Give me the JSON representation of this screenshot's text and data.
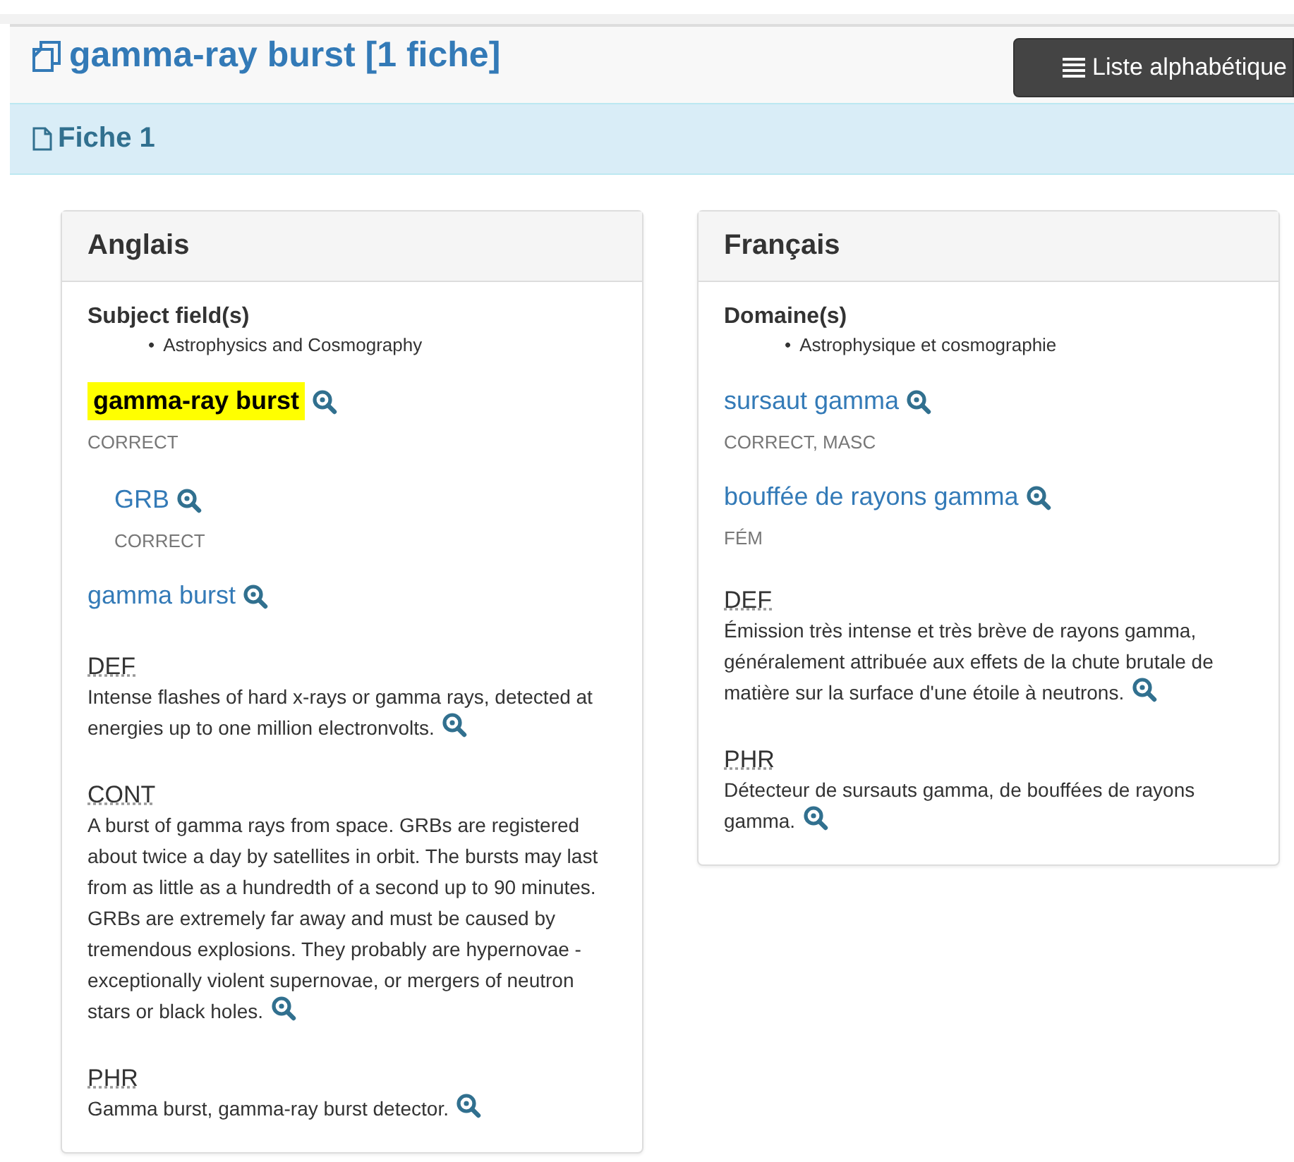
{
  "header": {
    "title": "gamma-ray burst [1 fiche]",
    "button": "Liste alphabétique"
  },
  "record": {
    "title": "Fiche 1"
  },
  "panels": [
    {
      "title": "Anglais",
      "field_label": "Subject field(s)",
      "bullet": "•",
      "fields": [
        "Astrophysics and Cosmography"
      ],
      "terms": [
        {
          "text": "gamma-ray burst",
          "highlighted": true,
          "status": "CORRECT",
          "children": [
            {
              "text": "GRB",
              "highlighted": false,
              "status": "CORRECT"
            }
          ]
        },
        {
          "text": "gamma burst",
          "highlighted": false
        }
      ],
      "notes": [
        {
          "label": "DEF",
          "text": "Intense flashes of hard x-rays or gamma rays, detected at energies up to one million electronvolts."
        },
        {
          "label": "CONT",
          "text": "A burst of gamma rays from space. GRBs are registered about twice a day by satellites in orbit. The bursts may last from as little as a hundredth of a second up to 90 minutes. GRBs are extremely far away and must be caused by tremendous explosions. They probably are hypernovae - exceptionally violent supernovae, or mergers of neutron stars or black holes."
        },
        {
          "label": "PHR",
          "text": "Gamma burst, gamma-ray burst detector."
        }
      ]
    },
    {
      "title": "Français",
      "field_label": "Domaine(s)",
      "bullet": "•",
      "fields": [
        "Astrophysique et cosmographie"
      ],
      "terms": [
        {
          "text": "sursaut gamma",
          "highlighted": false,
          "status": "CORRECT, MASC"
        },
        {
          "text": "bouffée de rayons gamma",
          "highlighted": false,
          "status": "FÉM"
        }
      ],
      "notes": [
        {
          "label": "DEF",
          "text": "Émission très intense et très brève de rayons gamma, généralement attribuée aux effets de la chute brutale de matière sur la surface d'une étoile à neutrons."
        },
        {
          "label": "PHR",
          "text": "Détecteur de sursauts gamma, de bouffées de rayons gamma."
        }
      ]
    }
  ]
}
